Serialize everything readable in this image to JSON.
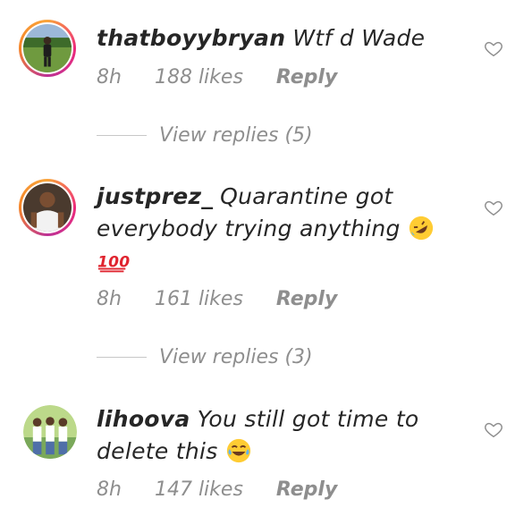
{
  "comments": [
    {
      "username": "thatboyybryan",
      "text": "Wtf d Wade",
      "time": "8h",
      "likes": "188 likes",
      "reply_label": "Reply",
      "avatar_icon": "person-on-grass-avatar",
      "has_story_ring": true
    },
    {
      "username": "justprez_",
      "text": "Quarantine got everybody trying anything",
      "emoji": "rolling-on-floor-laughing-emoji",
      "trailing_emoji": "hundred-points-emoji",
      "trailing_text": "100",
      "time": "8h",
      "likes": "161 likes",
      "reply_label": "Reply",
      "avatar_icon": "man-white-shirt-avatar",
      "has_story_ring": true
    },
    {
      "username": "lihoova",
      "text": "You still got time to delete this",
      "emoji": "tears-of-joy-emoji",
      "time": "8h",
      "likes": "147 likes",
      "reply_label": "Reply",
      "avatar_icon": "group-of-three-avatar",
      "has_story_ring": false
    }
  ],
  "view_replies": [
    {
      "label": "View replies (5)"
    },
    {
      "label": "View replies (3)"
    }
  ],
  "colors": {
    "text": "#262626",
    "meta": "#8e8e8e",
    "ring_start": "#f9a43a",
    "ring_end": "#ee2a7b"
  }
}
